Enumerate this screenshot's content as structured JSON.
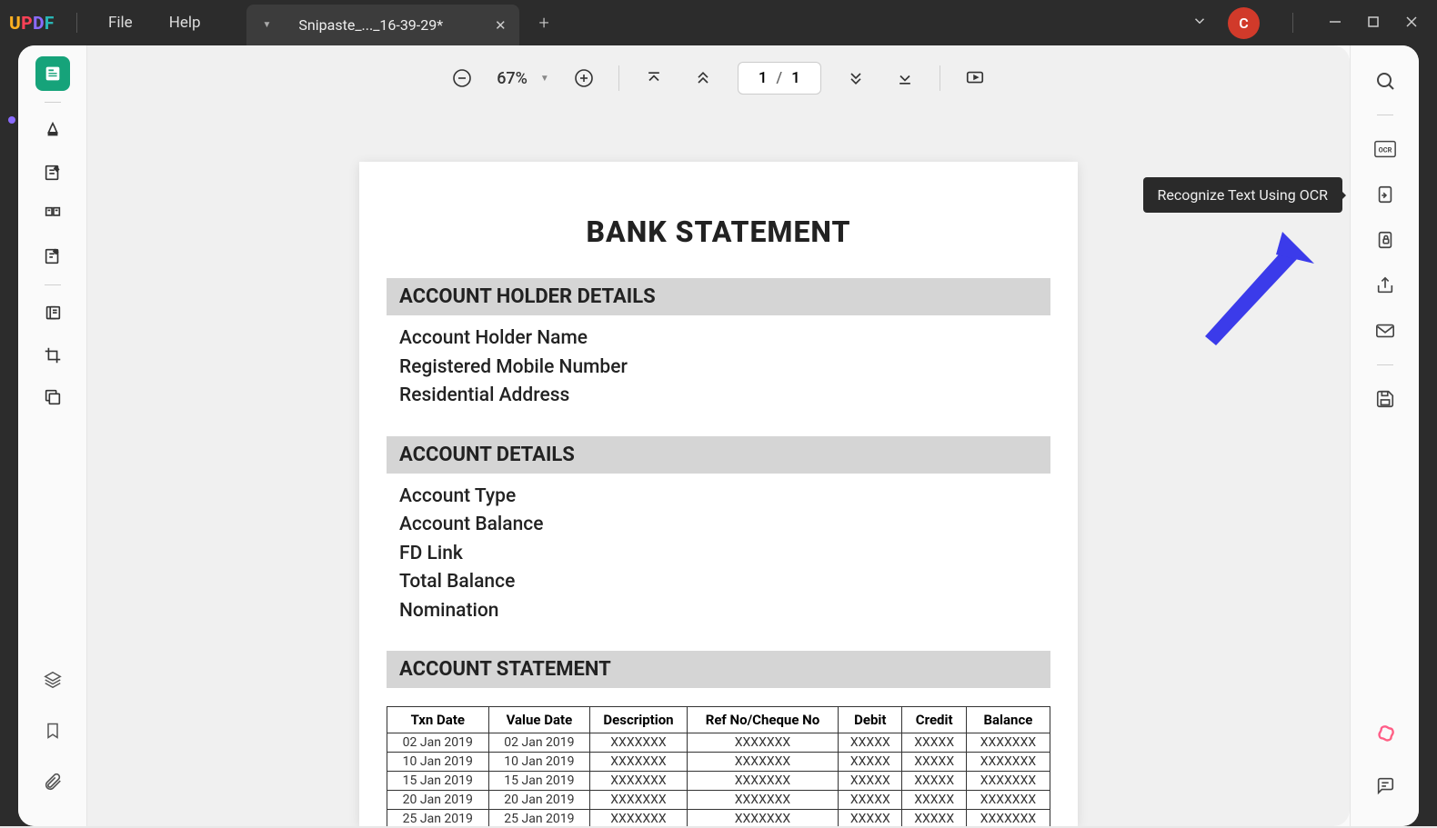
{
  "app": {
    "logo_u": "U",
    "logo_p": "P",
    "logo_d": "D",
    "logo_f": "F",
    "menu_file": "File",
    "menu_help": "Help",
    "tab_title": "Snipaste_..._16-39-29*",
    "avatar_letter": "C"
  },
  "toolbar": {
    "zoom": "67%",
    "page_current": "1",
    "page_total": "1"
  },
  "tooltip": "Recognize Text Using OCR",
  "doc": {
    "title": "BANK STATEMENT",
    "section1_title": "ACCOUNT HOLDER DETAILS",
    "section1_rows": {
      "r1": "Account Holder Name",
      "r2": "Registered Mobile Number",
      "r3": "Residential Address"
    },
    "section2_title": "ACCOUNT DETAILS",
    "section2_rows": {
      "r1": "Account Type",
      "r2": "Account Balance",
      "r3": "FD Link",
      "r4": "Total Balance",
      "r5": "Nomination"
    },
    "section3_title": "ACCOUNT STATEMENT",
    "table": {
      "headers": {
        "c1": "Txn Date",
        "c2": "Value Date",
        "c3": "Description",
        "c4": "Ref No/Cheque No",
        "c5": "Debit",
        "c6": "Credit",
        "c7": "Balance"
      },
      "rows": {
        "r1": {
          "c1": "02 Jan 2019",
          "c2": "02 Jan 2019",
          "c3": "XXXXXXX",
          "c4": "XXXXXXX",
          "c5": "XXXXX",
          "c6": "XXXXX",
          "c7": "XXXXXXX"
        },
        "r2": {
          "c1": "10 Jan 2019",
          "c2": "10 Jan 2019",
          "c3": "XXXXXXX",
          "c4": "XXXXXXX",
          "c5": "XXXXX",
          "c6": "XXXXX",
          "c7": "XXXXXXX"
        },
        "r3": {
          "c1": "15 Jan 2019",
          "c2": "15 Jan 2019",
          "c3": "XXXXXXX",
          "c4": "XXXXXXX",
          "c5": "XXXXX",
          "c6": "XXXXX",
          "c7": "XXXXXXX"
        },
        "r4": {
          "c1": "20 Jan 2019",
          "c2": "20 Jan 2019",
          "c3": "XXXXXXX",
          "c4": "XXXXXXX",
          "c5": "XXXXX",
          "c6": "XXXXX",
          "c7": "XXXXXXX"
        },
        "r5": {
          "c1": "25 Jan 2019",
          "c2": "25 Jan 2019",
          "c3": "XXXXXXX",
          "c4": "XXXXXXX",
          "c5": "XXXXX",
          "c6": "XXXXX",
          "c7": "XXXXXXX"
        }
      }
    }
  }
}
